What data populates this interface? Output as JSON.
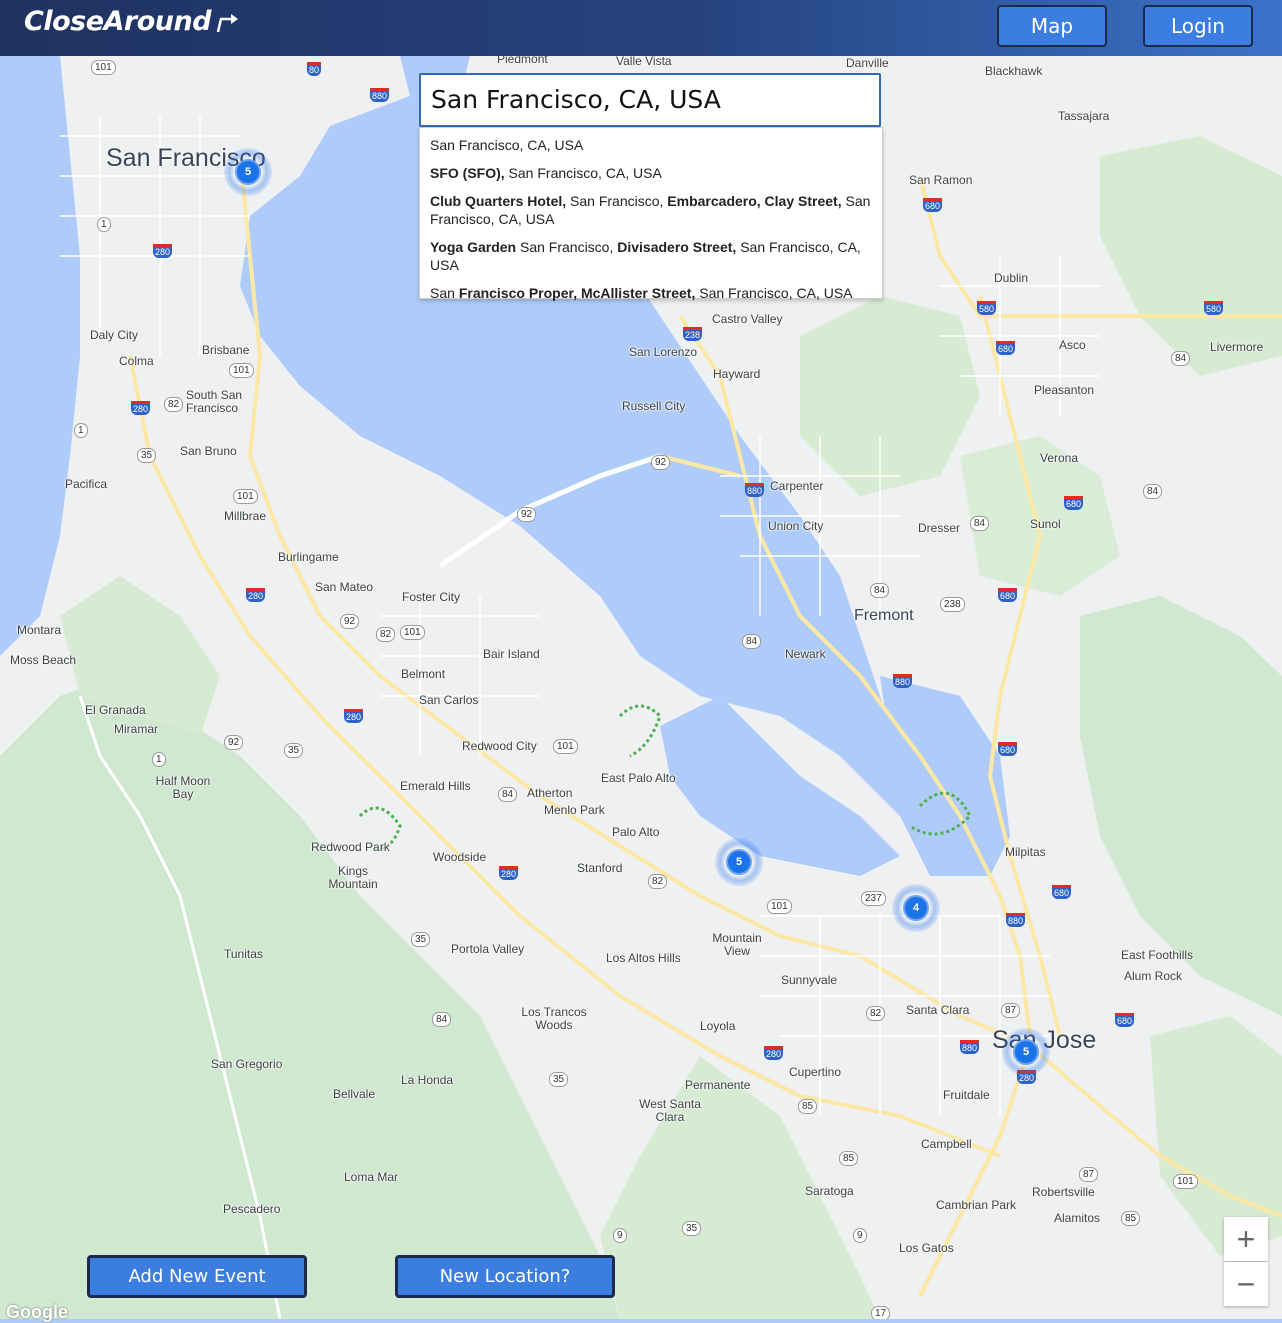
{
  "header": {
    "logo_text": "CloseAround",
    "map_label": "Map",
    "login_label": "Login"
  },
  "search": {
    "value": "San Francisco, CA, USA",
    "suggestions": [
      {
        "pre": "San Francisco, CA, USA",
        "bold": "",
        "post": ""
      },
      {
        "pre": "",
        "bold": "SFO (SFO),",
        "post": " San Francisco, CA, USA"
      },
      {
        "pre": "",
        "bold": "Club Quarters Hotel,",
        "post": " San Francisco, ",
        "bold2": "Embarcadero, Clay Street,",
        "post2": " San Francisco, CA, USA"
      },
      {
        "pre": "",
        "bold": "Yoga Garden",
        "post": " San Francisco, ",
        "bold2": "Divisadero Street,",
        "post2": " San Francisco, CA, USA"
      },
      {
        "pre": "San ",
        "bold": "Francisco Proper, McAllister Street,",
        "post": " San Francisco, CA, USA"
      }
    ]
  },
  "clusters": [
    {
      "count": "5"
    },
    {
      "count": "5"
    },
    {
      "count": "4"
    },
    {
      "count": "5"
    }
  ],
  "places": {
    "san_francisco": "San Francisco",
    "san_jose": "San Jose",
    "fremont": "Fremont",
    "daly_city": "Daly City",
    "colma": "Colma",
    "brisbane": "Brisbane",
    "south_sf": "South San Francisco",
    "san_bruno": "San Bruno",
    "pacifica": "Pacifica",
    "millbrae": "Millbrae",
    "burlingame": "Burlingame",
    "san_mateo": "San Mateo",
    "foster_city": "Foster City",
    "montara": "Montara",
    "moss_beach": "Moss Beach",
    "el_granada": "El Granada",
    "miramar": "Miramar",
    "half_moon_bay": "Half Moon Bay",
    "belmont": "Belmont",
    "san_carlos": "San Carlos",
    "bair_island": "Bair Island",
    "redwood_city": "Redwood City",
    "emerald_hills": "Emerald Hills",
    "atherton": "Atherton",
    "menlo_park": "Menlo Park",
    "east_palo_alto": "East Palo Alto",
    "palo_alto": "Palo Alto",
    "redwood_park": "Redwood Park",
    "kings_mountain": "Kings Mountain",
    "woodside": "Woodside",
    "stanford": "Stanford",
    "portola_valley": "Portola Valley",
    "los_altos_hills": "Los Altos Hills",
    "mountain_view": "Mountain View",
    "sunnyvale": "Sunnyvale",
    "santa_clara": "Santa Clara",
    "milpitas": "Milpitas",
    "tunitas": "Tunitas",
    "los_trancos_woods": "Los Trancos Woods",
    "loyola": "Loyola",
    "san_gregorio": "San Gregorio",
    "la_honda": "La Honda",
    "bellvale": "Bellvale",
    "permanente": "Permanente",
    "cupertino": "Cupertino",
    "west_santa_clara": "West Santa Clara",
    "fruitdale": "Fruitdale",
    "campbell": "Campbell",
    "saratoga": "Saratoga",
    "loma_mar": "Loma Mar",
    "pescadero": "Pescadero",
    "los_gatos": "Los Gatos",
    "cambrian_park": "Cambrian Park",
    "alamitos": "Alamitos",
    "robertsville": "Robertsville",
    "east_foothills": "East Foothills",
    "alum_rock": "Alum Rock",
    "newark": "Newark",
    "union_city": "Union City",
    "carpenter": "Carpenter",
    "dresser": "Dresser",
    "sunol": "Sunol",
    "verona": "Verona",
    "pleasanton": "Pleasanton",
    "asco": "Asco",
    "livermore": "Livermore",
    "dublin": "Dublin",
    "san_ramon": "San Ramon",
    "castro_valley": "Castro Valley",
    "san_lorenzo": "San Lorenzo",
    "hayward": "Hayward",
    "russell_city": "Russell City",
    "tassajara": "Tassajara",
    "blackhawk": "Blackhawk",
    "danville": "Danville",
    "valle_vista": "Valle Vista",
    "piedmont": "Piedmont"
  },
  "buttons": {
    "add_event": "Add New Event",
    "new_location": "New Location?"
  },
  "zoom": {
    "in": "+",
    "out": "−"
  },
  "attribution": "Google",
  "colors": {
    "accent": "#3c7de0",
    "water": "#aecbfa",
    "land": "#f1f3f4",
    "park": "#c8e6c9",
    "cluster": "#1a73e8"
  }
}
